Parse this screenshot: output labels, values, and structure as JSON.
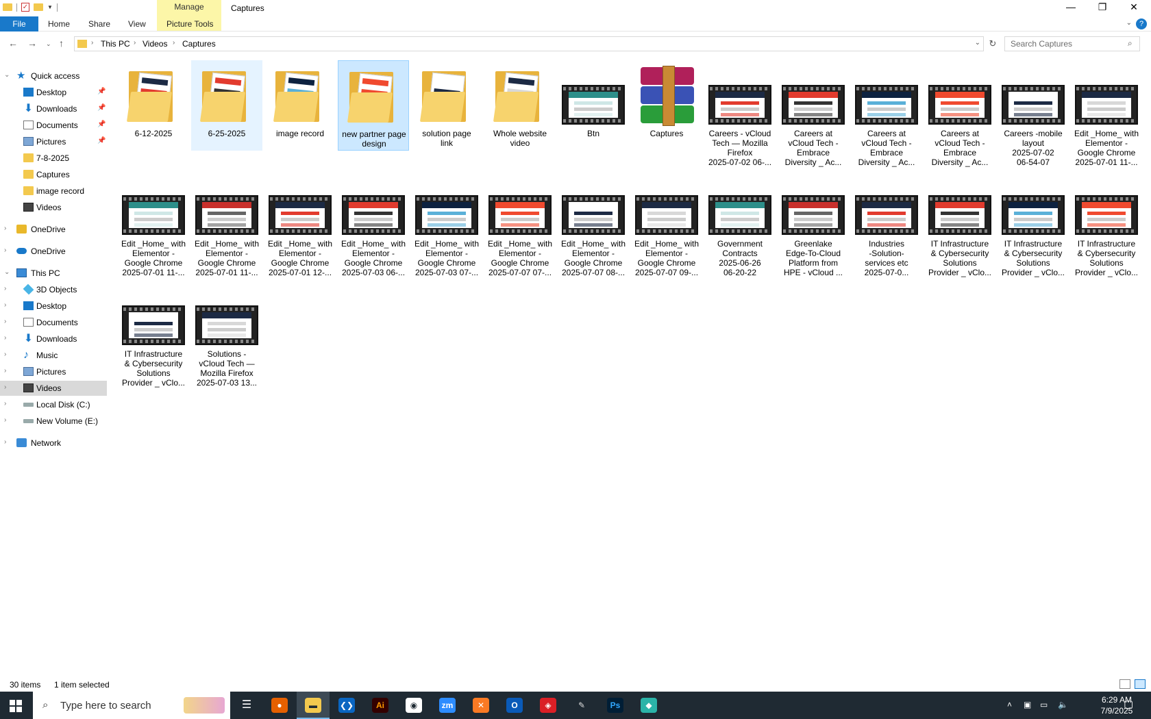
{
  "window": {
    "title": "Captures",
    "manage_label": "Manage",
    "minimize": "—",
    "restore": "❐",
    "close": "✕"
  },
  "ribbon": {
    "file": "File",
    "tabs": [
      "Home",
      "Share",
      "View",
      "Picture Tools"
    ],
    "help": "?"
  },
  "address": {
    "crumbs": [
      "This PC",
      "Videos",
      "Captures"
    ],
    "search_placeholder": "Search Captures"
  },
  "sidebar": {
    "items": [
      {
        "label": "Quick access",
        "icon": "star-icon",
        "pinned": false
      },
      {
        "label": "Desktop",
        "icon": "desktop-icon",
        "pinned": true
      },
      {
        "label": "Downloads",
        "icon": "download-icon",
        "pinned": true
      },
      {
        "label": "Documents",
        "icon": "documents-icon",
        "pinned": true
      },
      {
        "label": "Pictures",
        "icon": "pictures-icon",
        "pinned": true
      },
      {
        "label": "7-8-2025",
        "icon": "folder-icon",
        "pinned": false
      },
      {
        "label": "Captures",
        "icon": "folder-icon",
        "pinned": false
      },
      {
        "label": "image record",
        "icon": "folder-icon",
        "pinned": false
      },
      {
        "label": "Videos",
        "icon": "videos-icon",
        "pinned": false
      },
      {
        "label": "OneDrive",
        "icon": "onedrive-folder-icon",
        "pinned": false
      },
      {
        "label": "OneDrive",
        "icon": "onedrive-cloud-icon",
        "pinned": false
      },
      {
        "label": "This PC",
        "icon": "this-pc-icon",
        "pinned": false
      },
      {
        "label": "3D Objects",
        "icon": "3d-objects-icon",
        "pinned": false
      },
      {
        "label": "Desktop",
        "icon": "desktop-icon",
        "pinned": false
      },
      {
        "label": "Documents",
        "icon": "documents-icon",
        "pinned": false
      },
      {
        "label": "Downloads",
        "icon": "download-icon",
        "pinned": false
      },
      {
        "label": "Music",
        "icon": "music-icon",
        "pinned": false
      },
      {
        "label": "Pictures",
        "icon": "pictures-icon",
        "pinned": false
      },
      {
        "label": "Videos",
        "icon": "videos-icon",
        "pinned": false
      },
      {
        "label": "Local Disk (C:)",
        "icon": "disk-icon",
        "pinned": false
      },
      {
        "label": "New Volume (E:)",
        "icon": "disk-icon",
        "pinned": false
      },
      {
        "label": "Network",
        "icon": "network-icon",
        "pinned": false
      }
    ]
  },
  "files": [
    {
      "kind": "folder",
      "lines": [
        "6-12-2025"
      ]
    },
    {
      "kind": "folder",
      "lines": [
        "6-25-2025"
      ],
      "state": "hovered"
    },
    {
      "kind": "folder",
      "lines": [
        "image record"
      ]
    },
    {
      "kind": "folder",
      "lines": [
        "new partner page",
        "design"
      ],
      "state": "selected"
    },
    {
      "kind": "folder",
      "lines": [
        "solution page",
        "link"
      ]
    },
    {
      "kind": "folder",
      "lines": [
        "Whole website",
        "video"
      ]
    },
    {
      "kind": "video",
      "lines": [
        "Btn"
      ]
    },
    {
      "kind": "archive",
      "lines": [
        "Captures"
      ]
    },
    {
      "kind": "video",
      "lines": [
        "Careers - vCloud",
        "Tech — Mozilla",
        "Firefox",
        "2025-07-02 06-..."
      ]
    },
    {
      "kind": "video",
      "lines": [
        "Careers at",
        "vCloud Tech -",
        "Embrace",
        "Diversity _ Ac..."
      ]
    },
    {
      "kind": "video",
      "lines": [
        "Careers at",
        "vCloud Tech -",
        "Embrace",
        "Diversity _ Ac..."
      ]
    },
    {
      "kind": "video",
      "lines": [
        "Careers at",
        "vCloud Tech -",
        "Embrace",
        "Diversity _ Ac..."
      ]
    },
    {
      "kind": "video",
      "lines": [
        "Careers -mobile",
        "layout",
        "2025-07-02",
        "06-54-07"
      ]
    },
    {
      "kind": "video",
      "lines": [
        "Edit _Home_ with",
        "Elementor -",
        "Google Chrome",
        "2025-07-01 11-..."
      ]
    },
    {
      "kind": "video",
      "lines": [
        "Edit _Home_ with",
        "Elementor -",
        "Google Chrome",
        "2025-07-01 11-..."
      ]
    },
    {
      "kind": "video",
      "lines": [
        "Edit _Home_ with",
        "Elementor -",
        "Google Chrome",
        "2025-07-01 11-..."
      ]
    },
    {
      "kind": "video",
      "lines": [
        "Edit _Home_ with",
        "Elementor -",
        "Google Chrome",
        "2025-07-01 12-..."
      ]
    },
    {
      "kind": "video",
      "lines": [
        "Edit _Home_ with",
        "Elementor -",
        "Google Chrome",
        "2025-07-03 06-..."
      ]
    },
    {
      "kind": "video",
      "lines": [
        "Edit _Home_ with",
        "Elementor -",
        "Google Chrome",
        "2025-07-03 07-..."
      ]
    },
    {
      "kind": "video",
      "lines": [
        "Edit _Home_ with",
        "Elementor -",
        "Google Chrome",
        "2025-07-07 07-..."
      ]
    },
    {
      "kind": "video",
      "lines": [
        "Edit _Home_ with",
        "Elementor -",
        "Google Chrome",
        "2025-07-07 08-..."
      ]
    },
    {
      "kind": "video",
      "lines": [
        "Edit _Home_ with",
        "Elementor -",
        "Google Chrome",
        "2025-07-07 09-..."
      ]
    },
    {
      "kind": "video",
      "lines": [
        "Government",
        "Contracts",
        "2025-06-26",
        "06-20-22"
      ]
    },
    {
      "kind": "video",
      "lines": [
        "Greenlake",
        "Edge-To-Cloud",
        "Platform from",
        "HPE - vCloud ..."
      ]
    },
    {
      "kind": "video",
      "lines": [
        "Industries",
        "-Solution-",
        "services etc",
        "2025-07-0..."
      ]
    },
    {
      "kind": "video",
      "lines": [
        "IT Infrastructure",
        "& Cybersecurity",
        "Solutions",
        "Provider _ vClo..."
      ]
    },
    {
      "kind": "video",
      "lines": [
        "IT Infrastructure",
        "& Cybersecurity",
        "Solutions",
        "Provider _ vClo..."
      ]
    },
    {
      "kind": "video",
      "lines": [
        "IT Infrastructure",
        "& Cybersecurity",
        "Solutions",
        "Provider _ vClo..."
      ]
    },
    {
      "kind": "video",
      "lines": [
        "IT Infrastructure",
        "& Cybersecurity",
        "Solutions",
        "Provider _ vClo..."
      ]
    },
    {
      "kind": "video",
      "lines": [
        "Solutions -",
        "vCloud Tech —",
        "Mozilla Firefox",
        "2025-07-03 13..."
      ]
    }
  ],
  "status": {
    "count": "30 items",
    "selection": "1 item selected"
  },
  "taskbar": {
    "search_placeholder": "Type here to search",
    "apps": [
      "Firefox",
      "File Explorer",
      "Visual Studio Code",
      "Ai",
      "Chrome",
      "zm",
      "XAMPP",
      "Outlook",
      "Creative Cloud",
      "Pen tool",
      "Ps",
      "App"
    ],
    "clock_time": "6:29 AM",
    "clock_date": "7/9/2025"
  },
  "colors": {
    "accent": "#1979ca",
    "selection_bg": "#cce8ff",
    "manage_tab": "#fcf6a8",
    "taskbar": "#1f2a33"
  }
}
